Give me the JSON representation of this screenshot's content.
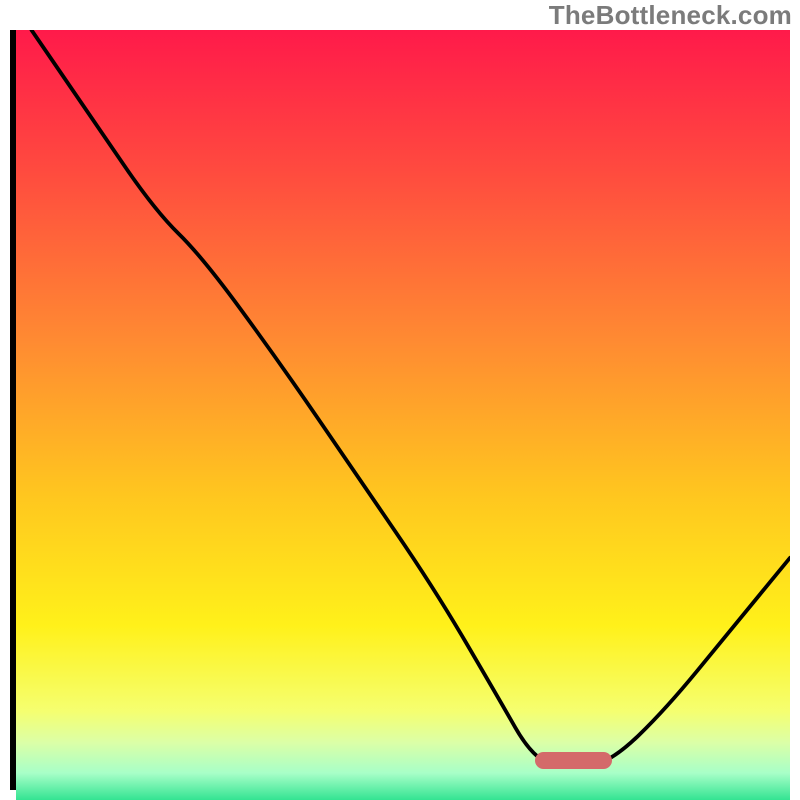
{
  "watermark": "TheBottleneck.com",
  "colors": {
    "curve": "#000000",
    "frame": "#000000",
    "sweet_spot": "#d46a6a",
    "gradient_stops": [
      {
        "offset": 0.0,
        "color": "#ff1a4a"
      },
      {
        "offset": 0.18,
        "color": "#ff4a3f"
      },
      {
        "offset": 0.4,
        "color": "#ff8a32"
      },
      {
        "offset": 0.6,
        "color": "#ffc61f"
      },
      {
        "offset": 0.77,
        "color": "#fff11a"
      },
      {
        "offset": 0.88,
        "color": "#f5ff70"
      },
      {
        "offset": 0.92,
        "color": "#dcffa6"
      },
      {
        "offset": 0.96,
        "color": "#a8ffc8"
      },
      {
        "offset": 1.0,
        "color": "#22e08a"
      }
    ]
  },
  "chart_data": {
    "type": "line",
    "title": "",
    "xlabel": "",
    "ylabel": "",
    "xlim": [
      0,
      100
    ],
    "ylim": [
      0,
      100
    ],
    "sweet_spot": {
      "x_start": 67,
      "x_end": 77,
      "y": 3
    },
    "curve_points": [
      {
        "x": 2,
        "y": 100
      },
      {
        "x": 10,
        "y": 88
      },
      {
        "x": 18,
        "y": 76
      },
      {
        "x": 24,
        "y": 70
      },
      {
        "x": 34,
        "y": 56
      },
      {
        "x": 44,
        "y": 41
      },
      {
        "x": 54,
        "y": 26
      },
      {
        "x": 62,
        "y": 12
      },
      {
        "x": 67,
        "y": 3
      },
      {
        "x": 72,
        "y": 2
      },
      {
        "x": 77,
        "y": 3
      },
      {
        "x": 84,
        "y": 10
      },
      {
        "x": 92,
        "y": 20
      },
      {
        "x": 100,
        "y": 30
      }
    ],
    "curve_stroke_width": 3.8
  }
}
